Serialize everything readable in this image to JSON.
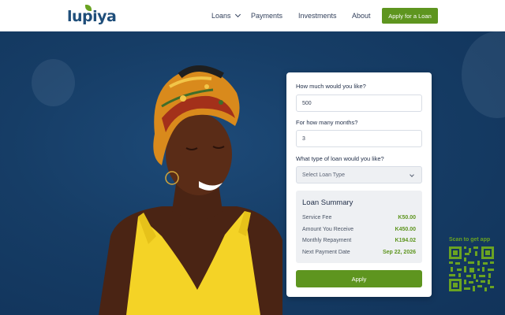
{
  "brand": {
    "logo_text": "lupiya",
    "accent": "#5e951f",
    "navy": "#14355c"
  },
  "nav": {
    "items": [
      {
        "label": "Loans",
        "has_dropdown": true
      },
      {
        "label": "Payments"
      },
      {
        "label": "Investments"
      },
      {
        "label": "About"
      }
    ],
    "cta": "Apply for a Loan"
  },
  "form": {
    "amount_question": "How much would you like?",
    "amount_value": "500",
    "months_question": "For how many months?",
    "months_value": "3",
    "type_question": "What type of loan would you like?",
    "type_placeholder": "Select Loan Type",
    "apply_label": "Apply"
  },
  "summary": {
    "title": "Loan Summary",
    "rows": [
      {
        "label": "Service Fee",
        "value": "K50.00"
      },
      {
        "label": "Amount You Receive",
        "value": "K450.00"
      },
      {
        "label": "Monthly Repayment",
        "value": "K194.02"
      },
      {
        "label": "Next Payment Date",
        "value": "Sep 22, 2026"
      }
    ]
  },
  "qr": {
    "label": "Scan to get app",
    "icon": "qr-code-icon"
  }
}
